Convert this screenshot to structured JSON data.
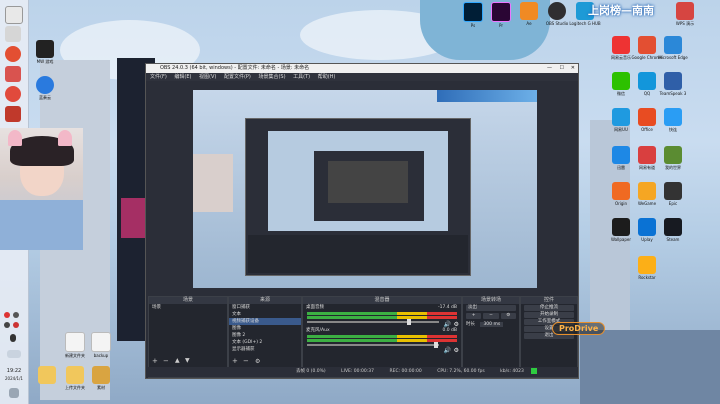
{
  "taskbar": {
    "clock_time": "19:22",
    "clock_date": "2024/1/1"
  },
  "desktop": {
    "left_icons": [
      {
        "label": "MW 游戏"
      },
      {
        "label": "蓝奏云"
      }
    ],
    "top_icons": [
      {
        "label": "Ps"
      },
      {
        "label": "Pr"
      },
      {
        "label": "Ae"
      },
      {
        "label": "OBS Studio"
      },
      {
        "label": "Logitech G HUB"
      },
      {
        "label": "PotPlayer"
      },
      {
        "label": "WPS 演示"
      }
    ],
    "right_icons": [
      {
        "label": "网易云音乐"
      },
      {
        "label": "Google Chrome"
      },
      {
        "label": "Microsoft Edge"
      },
      {
        "label": "微信"
      },
      {
        "label": "QQ"
      },
      {
        "label": "TeamSpeak 3"
      },
      {
        "label": "网易UU"
      },
      {
        "label": "Office"
      },
      {
        "label": "快连"
      },
      {
        "label": "迅雷"
      },
      {
        "label": "网易有道"
      },
      {
        "label": "我的世界"
      },
      {
        "label": "Origin"
      },
      {
        "label": "WeGame"
      },
      {
        "label": "Epic"
      },
      {
        "label": "Wallpaper"
      },
      {
        "label": "Uplay"
      },
      {
        "label": "Steam"
      },
      {
        "label": "Rockstar"
      }
    ],
    "bottom_icons": [
      {
        "label": "新建文件夹"
      },
      {
        "label": "backup"
      },
      {
        "label": "上传文件夹"
      },
      {
        "label": "素材"
      }
    ],
    "banner_text": "上岗榜—南南"
  },
  "obs": {
    "title": "OBS 24.0.3 (64 bit, windows) - 配置文件: 未命名 - 场景: 未命名",
    "menu": [
      "文件(F)",
      "编辑(E)",
      "视图(V)",
      "配置文件(P)",
      "场景集合(S)",
      "工具(T)",
      "帮助(H)"
    ],
    "window_controls": [
      "—",
      "☐",
      "✕"
    ],
    "docks": {
      "scenes": {
        "title": "场景",
        "items": [
          "场景"
        ]
      },
      "sources": {
        "title": "来源",
        "items": [
          "窗口捕获",
          "文本",
          "视频捕获设备",
          "图像",
          "图像 2",
          "文本 (GDI+) 2",
          "显示器捕获"
        ]
      },
      "mixer": {
        "title": "混音器",
        "channels": [
          {
            "name": "桌面音频",
            "db": "-17.4 dB"
          },
          {
            "name": "麦克风/Aux",
            "db": "0.0 dB"
          }
        ]
      },
      "transitions": {
        "title": "场景转场",
        "type": "淡出",
        "duration_label": "时长",
        "duration": "300 ms"
      },
      "controls": {
        "title": "控件",
        "buttons": [
          "停止推流",
          "开始录制",
          "工作室模式",
          "设置",
          "退出"
        ]
      }
    },
    "status": {
      "dropped": "丢帧 0 (0.0%)",
      "live": "LIVE: 00:00:37",
      "rec": "REC: 00:00:00",
      "cpu": "CPU: 7.2%, 60.00 fps",
      "kbps": "kb/s: 4023"
    },
    "watermark": "ProDrive"
  }
}
